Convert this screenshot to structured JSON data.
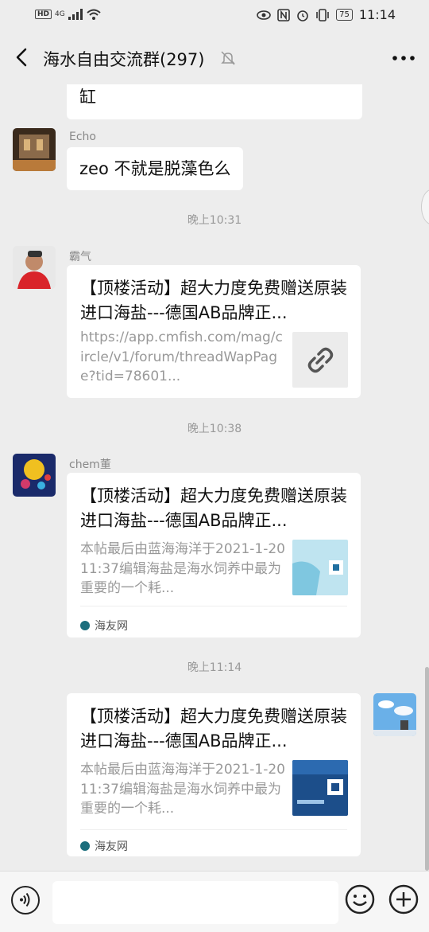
{
  "status_bar": {
    "left_badge": "HD",
    "network": "4G",
    "battery": "75",
    "time": "11:14"
  },
  "header": {
    "title": "海水自由交流群(297)"
  },
  "messages": {
    "partial_text": "缸",
    "echo": {
      "name": "Echo",
      "text": "zeo 不就是脱藻色么"
    },
    "ts1": "晚上10:31",
    "baqi": {
      "name": "霸气",
      "title": "【顶楼活动】超大力度免费赠送原装进口海盐---德国AB品牌正...",
      "desc": "https://app.cmfish.com/mag/circle/v1/forum/threadWapPage?tid=78601..."
    },
    "ts2": "晚上10:38",
    "chem": {
      "name": "chem董",
      "title": "【顶楼活动】超大力度免费赠送原装进口海盐---德国AB品牌正...",
      "desc": "本帖最后由蓝海海洋于2021-1-2011:37编辑海盐是海水饲养中最为重要的一个耗...",
      "source": "海友网"
    },
    "ts3": "晚上11:14",
    "me": {
      "title": "【顶楼活动】超大力度免费赠送原装进口海盐---德国AB品牌正...",
      "desc": "本帖最后由蓝海海洋于2021-1-2011:37编辑海盐是海水饲养中最为重要的一个耗...",
      "source": "海友网"
    }
  },
  "icons": {
    "back": "back-arrow-icon",
    "mute": "mute-bell-icon",
    "more": "more-dots-icon",
    "link": "link-icon",
    "voice": "voice-icon",
    "emoji": "emoji-icon",
    "plus": "plus-icon"
  },
  "colors": {
    "background": "#ededed",
    "bubble": "#ffffff",
    "muted_text": "#999999",
    "source_dot": "#1c6e7d"
  }
}
